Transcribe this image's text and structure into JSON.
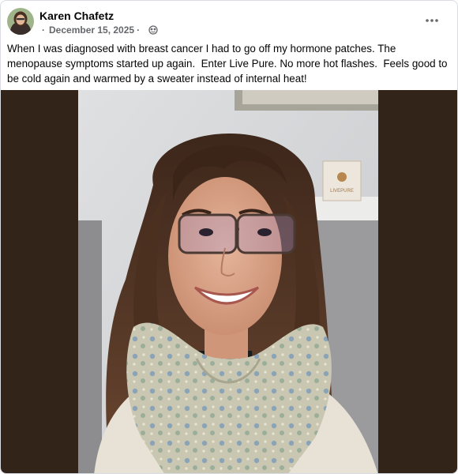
{
  "post": {
    "author": "Karen Chafetz",
    "date": "December 15, 2025",
    "separator": "·",
    "audience_icon": "globe-icon",
    "more_icon": "more-options-icon",
    "text": "When I was diagnosed with breast cancer I had to go off my hormone patches. The menopause symptoms started up again.  Enter Live Pure. No more hot flashes.  Feels good to be cold again and warmed by a sweater instead of internal heat!"
  },
  "photo": {
    "product_label": "LIVEPURE"
  },
  "colors": {
    "media_background": "#322419",
    "meta_text": "#65676b",
    "border": "#dadde1"
  }
}
